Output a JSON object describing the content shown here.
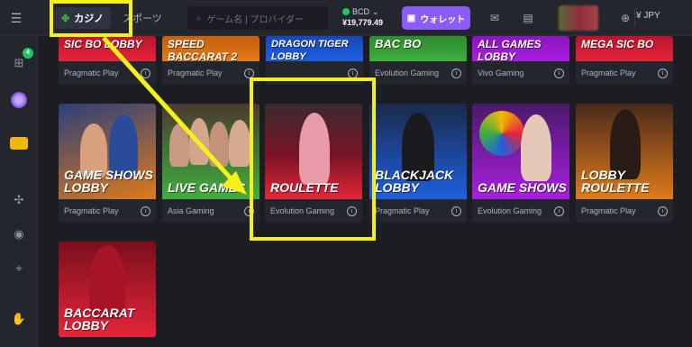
{
  "header": {
    "menu_icon": "hamburger-icon",
    "tabs": [
      {
        "label": "カジノ",
        "icon": "casino-icon",
        "active": true
      },
      {
        "label": "スポーツ",
        "icon": "",
        "active": false
      }
    ],
    "search_placeholder": "ゲーム名 | プロバイダー",
    "balance_currency": "BCD",
    "balance_amount": "¥19,779.49",
    "wallet_label": "ウォレット",
    "currency": "¥ JPY"
  },
  "sidebar": {
    "badge": "4"
  },
  "colors": {
    "accent": "#8b5cf6",
    "highlight": "#f5f01b",
    "pragmatic_red": "#e5253a",
    "orange": "#e07a1a",
    "blue": "#1f5fe0",
    "green": "#3fae3f",
    "purple": "#a81ee0"
  },
  "top_row": [
    {
      "label": "SIC BO LOBBY",
      "provider": "Pragmatic Play"
    },
    {
      "label": "SPEED BACCARAT 2",
      "provider": "Pragmatic Play"
    },
    {
      "label": "DRAGON TIGER LOBBY",
      "provider": ""
    },
    {
      "label": "BAC BO",
      "provider": "Evolution Gaming"
    },
    {
      "label": "ALL GAMES LOBBY",
      "provider": "Vivo Gaming"
    },
    {
      "label": "MEGA SIC BO",
      "provider": "Pragmatic Play"
    }
  ],
  "middle_row": [
    {
      "label": "GAME SHOWS LOBBY",
      "provider": "Pragmatic Play"
    },
    {
      "label": "LIVE GAMES",
      "provider": "Asia Gaming"
    },
    {
      "label": "ROULETTE",
      "provider": "Evolution Gaming"
    },
    {
      "label": "BLACKJACK LOBBY",
      "provider": "Pragmatic Play"
    },
    {
      "label": "GAME SHOWS",
      "provider": "Evolution Gaming"
    },
    {
      "label": "LOBBY ROULETTE",
      "provider": "Pragmatic Play"
    }
  ],
  "bottom_row": [
    {
      "label": "BACCARAT LOBBY",
      "provider": ""
    }
  ]
}
